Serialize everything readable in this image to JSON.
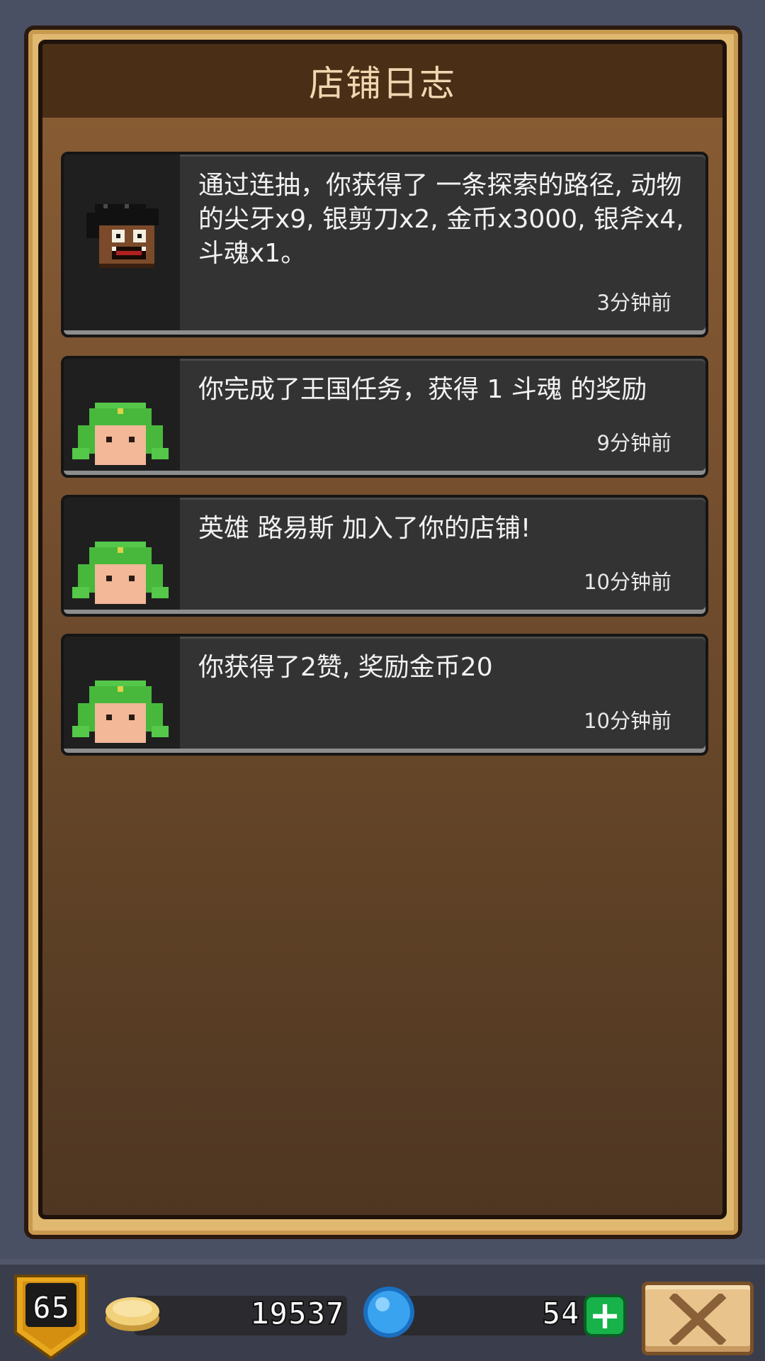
{
  "panel": {
    "title": "店铺日志"
  },
  "logs": [
    {
      "avatar": "monster-avatar",
      "message": "通过连抽，你获得了 一条探索的路径, 动物的尖牙x9, 银剪刀x2, 金币x3000, 银斧x4, 斗魂x1。",
      "time": "3分钟前"
    },
    {
      "avatar": "green-hat-hero-avatar",
      "message": "你完成了王国任务，获得 1 斗魂 的奖励",
      "time": "9分钟前"
    },
    {
      "avatar": "green-hat-hero-avatar",
      "message": "英雄 路易斯 加入了你的店铺!",
      "time": "10分钟前"
    },
    {
      "avatar": "green-hat-hero-avatar",
      "message": "你获得了2赞, 奖励金币20",
      "time": "10分钟前"
    }
  ],
  "status_bar": {
    "level": "65",
    "gold": "19537",
    "gems": "54",
    "add_gems_label": "+"
  },
  "colors": {
    "panel_frame": "#e0b870",
    "panel_header": "#4a2e16",
    "title_text": "#f1d7b0",
    "card_bg": "#333333",
    "add_button": "#17b24a",
    "gold": "#f1d17a",
    "gem": "#3aa3f0"
  },
  "icons": [
    "gold-coin-icon",
    "blue-gem-icon",
    "close-x-icon",
    "level-shield-icon"
  ]
}
